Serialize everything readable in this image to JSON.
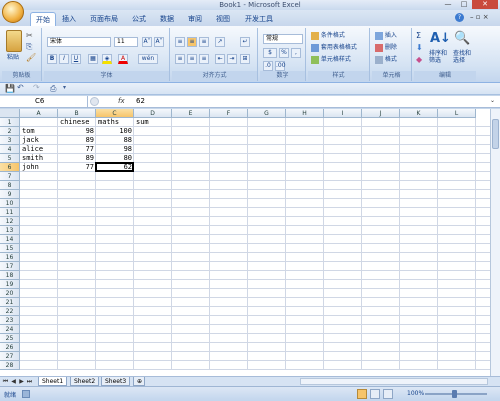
{
  "window": {
    "title": "Book1 - Microsoft Excel"
  },
  "tabs": [
    {
      "label": "开始",
      "active": true
    },
    {
      "label": "插入"
    },
    {
      "label": "页面布局"
    },
    {
      "label": "公式"
    },
    {
      "label": "数据"
    },
    {
      "label": "审阅"
    },
    {
      "label": "视图"
    },
    {
      "label": "开发工具"
    }
  ],
  "ribbon": {
    "clipboard": {
      "label": "剪贴板",
      "paste": "粘贴"
    },
    "font": {
      "label": "字体",
      "font_name": "宋体",
      "font_size": "11",
      "bold": "B",
      "italic": "I",
      "underline": "U",
      "grow": "A˄",
      "shrink": "A˅",
      "phonetic": "wén"
    },
    "alignment": {
      "label": "对齐方式"
    },
    "number": {
      "label": "数字",
      "format": "常规",
      "percent": "%",
      "comma": ","
    },
    "styles": {
      "label": "样式",
      "cond": "条件格式",
      "table": "套用表格格式",
      "cell": "单元格样式"
    },
    "cells": {
      "label": "单元格",
      "insert": "插入",
      "delete": "删除",
      "format": "格式"
    },
    "editing": {
      "label": "编辑",
      "sort": "排序和筛选",
      "find": "查找和选择",
      "sigma": "Σ"
    }
  },
  "formula_bar": {
    "name_box": "C6",
    "fx": "fx",
    "value": "62"
  },
  "columns": [
    "A",
    "B",
    "C",
    "D",
    "E",
    "F",
    "G",
    "H",
    "I",
    "J",
    "K",
    "L"
  ],
  "rows": [
    "1",
    "2",
    "3",
    "4",
    "5",
    "6",
    "7",
    "8",
    "9",
    "10",
    "11",
    "12",
    "13",
    "14",
    "15",
    "16",
    "17",
    "18",
    "19",
    "20",
    "21",
    "22",
    "23",
    "24",
    "25",
    "26",
    "27",
    "28"
  ],
  "cells": {
    "B1": "chinese",
    "C1": "maths",
    "D1": "sum",
    "A2": "tom",
    "B2": "98",
    "C2": "100",
    "A3": "jack",
    "B3": "89",
    "C3": "88",
    "A4": "alice",
    "B4": "77",
    "C4": "98",
    "A5": "smith",
    "B5": "89",
    "C5": "80",
    "A6": "john",
    "B6": "77",
    "C6": "62"
  },
  "active_cell": "C6",
  "sheets": [
    {
      "label": "Sheet1",
      "active": true
    },
    {
      "label": "Sheet2"
    },
    {
      "label": "Sheet3"
    }
  ],
  "status": {
    "ready": "就绪",
    "zoom": "100%"
  }
}
